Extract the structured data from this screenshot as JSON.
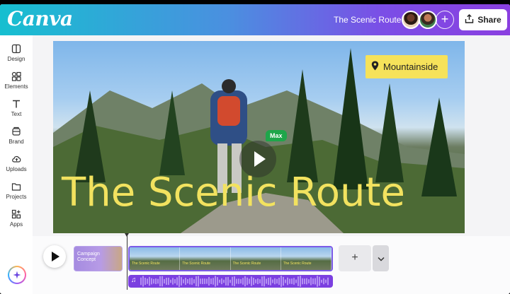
{
  "app": {
    "logo": "Canva"
  },
  "header": {
    "document_title": "The Scenic Route",
    "share_label": "Share",
    "add_label": "+"
  },
  "sidebar": {
    "items": [
      {
        "label": "Design",
        "icon": "design-icon"
      },
      {
        "label": "Elements",
        "icon": "elements-icon"
      },
      {
        "label": "Text",
        "icon": "text-icon"
      },
      {
        "label": "Brand",
        "icon": "brand-icon"
      },
      {
        "label": "Uploads",
        "icon": "uploads-icon"
      },
      {
        "label": "Projects",
        "icon": "projects-icon"
      },
      {
        "label": "Apps",
        "icon": "apps-icon"
      }
    ]
  },
  "canvas": {
    "headline": "The Scenic Route",
    "location_tag": "Mountainside",
    "collaborator_cursor": "Max"
  },
  "timeline": {
    "clip1_title": "Campaign Concept",
    "thumb_label": "The Scenic Route",
    "add_label": "+"
  },
  "colors": {
    "accent": "#7b5ae8",
    "headline": "#f2e25f",
    "tag": "#f6e25a",
    "cursor": "#1ea64a"
  }
}
